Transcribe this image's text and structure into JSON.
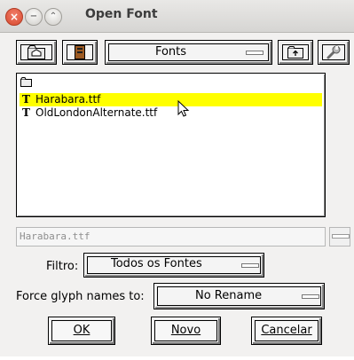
{
  "window": {
    "title": "Open Font",
    "close_glyph": "×",
    "minimize_glyph": "−",
    "maximize_glyph": "⌃"
  },
  "toolbar": {
    "directory_label": "Fonts"
  },
  "files": [
    {
      "name": "..",
      "icon": "folder-up-icon",
      "selected": false
    },
    {
      "name": "Harabara.ttf",
      "icon": "truetype-icon",
      "selected": true
    },
    {
      "name": "OldLondonAlternate.ttf",
      "icon": "truetype-icon",
      "selected": false
    }
  ],
  "filename_field": {
    "value": "Harabara.ttf"
  },
  "filter": {
    "label": "Filtro:",
    "value": "Todos os Fontes"
  },
  "glyph_names": {
    "label": "Force glyph names to:",
    "value": "No Rename"
  },
  "buttons": {
    "ok": "OK",
    "new": "Novo",
    "cancel": "Cancelar"
  },
  "colors": {
    "selection": "#ffff00",
    "close_button": "#e35d42"
  }
}
